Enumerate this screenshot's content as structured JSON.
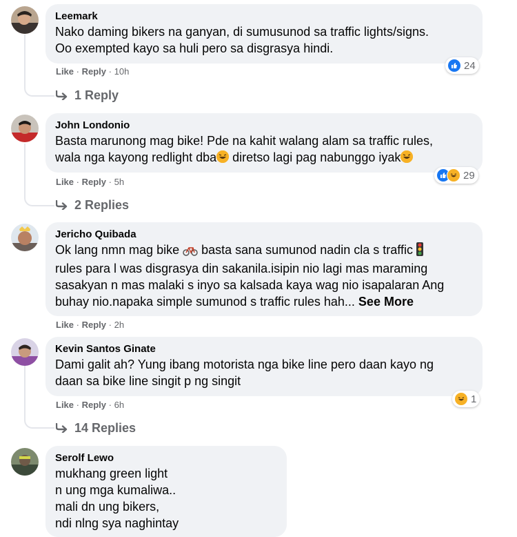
{
  "actions": {
    "like": "Like",
    "reply": "Reply",
    "sep": "·"
  },
  "comments": [
    {
      "author": "Leemark",
      "lines": [
        "Nako daming bikers na ganyan, di sumusunod sa traffic lights/signs.",
        "Oo exempted kayo sa huli pero sa disgrasya hindi."
      ],
      "time": "10h",
      "reaction_count": "24",
      "replies": "1 Reply"
    },
    {
      "author": "John Londonio",
      "lines": [
        "Basta marunong mag bike! Pde na kahit walang alam sa traffic rules,",
        "wala nga kayong redlight dba",
        " diretso lagi pag nabunggo iyak"
      ],
      "time": "5h",
      "reaction_count": "29",
      "replies": "2 Replies"
    },
    {
      "author": "Jericho Quibada",
      "lines": [
        "Ok lang nmn mag bike",
        " basta sana sumunod nadin cla s traffic",
        "rules para l was disgrasya din sakanila.isipin nio lagi mas maraming",
        "sasakyan n mas malaki s inyo sa kalsada kaya wag nio isapalaran Ang",
        "buhay nio.napaka simple sumunod s traffic rules hah... "
      ],
      "see_more": "See More",
      "time": "2h"
    },
    {
      "author": "Kevin Santos Ginate",
      "lines": [
        "Dami galit ah? Yung ibang motorista nga bike line pero daan kayo ng",
        "daan sa bike line singit p ng singit"
      ],
      "time": "6h",
      "reaction_count": "1",
      "replies": "14 Replies"
    },
    {
      "author": "Serolf Lewo",
      "lines": [
        "mukhang green light",
        "n ung mga kumaliwa..",
        "mali dn ung bikers,",
        "ndi nlng sya naghintay"
      ]
    }
  ]
}
